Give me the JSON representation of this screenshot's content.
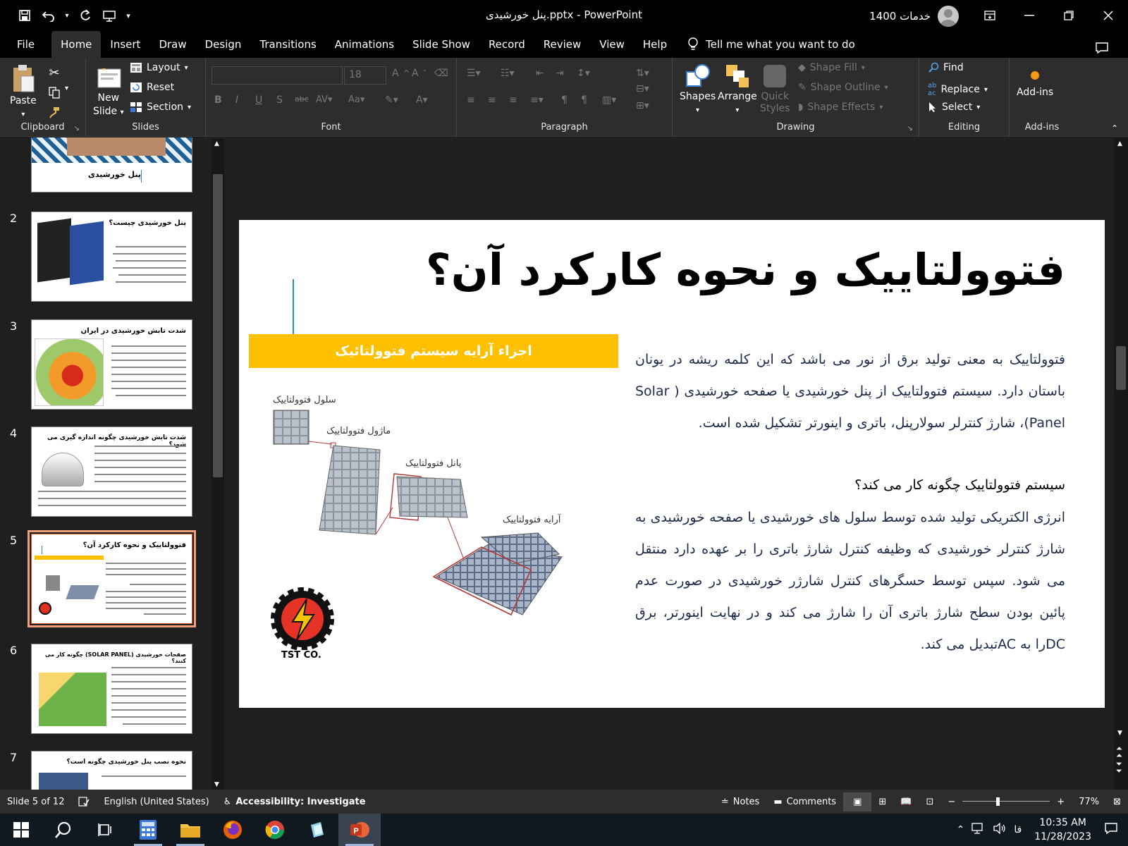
{
  "window": {
    "doc_title": "پنل خورشیدی.pptx  -  PowerPoint",
    "account_name": "خدمات 1400"
  },
  "menu": {
    "tabs": [
      "File",
      "Home",
      "Insert",
      "Draw",
      "Design",
      "Transitions",
      "Animations",
      "Slide Show",
      "Record",
      "Review",
      "View",
      "Help"
    ],
    "tell_me": "Tell me what you want to do"
  },
  "ribbon": {
    "clipboard": {
      "paste": "Paste",
      "label": "Clipboard"
    },
    "slides": {
      "new_slide_1": "New",
      "new_slide_2": "Slide",
      "layout": "Layout",
      "reset": "Reset",
      "section": "Section",
      "label": "Slides"
    },
    "font": {
      "size": "18",
      "label": "Font"
    },
    "paragraph": {
      "label": "Paragraph"
    },
    "drawing": {
      "shapes": "Shapes",
      "arrange": "Arrange",
      "quick_1": "Quick",
      "quick_2": "Styles",
      "shape_fill": "Shape Fill",
      "shape_outline": "Shape Outline",
      "shape_effects": "Shape Effects",
      "label": "Drawing"
    },
    "editing": {
      "find": "Find",
      "replace": "Replace",
      "select": "Select",
      "label": "Editing"
    },
    "addins": {
      "button": "Add-ins",
      "label": "Add-ins"
    }
  },
  "thumbnails": [
    {
      "num": "",
      "title": "پنل خورشیدی"
    },
    {
      "num": "2",
      "title": "پنل خورشیدی چیست؟"
    },
    {
      "num": "3",
      "title": "شدت تابش خورشیدی در ایران"
    },
    {
      "num": "4",
      "title": "شدت تابش خورشیدی چگونه اندازه گیری می شود؟"
    },
    {
      "num": "5",
      "title": "فتوولتاییک و نحوه کارکرد آن؟"
    },
    {
      "num": "6",
      "title": "صفحات خورشیدی (SOLAR PANEL) چگونه کار می کنند؟"
    },
    {
      "num": "7",
      "title": "نحوه نصب پنل خورشیدی چگونه است؟"
    }
  ],
  "slide": {
    "title": "فتوولتاییک و نحوه کارکرد آن؟",
    "banner": "اجزاء آرایه سیستم فتوولتائیک",
    "labels": {
      "cell": "سلول فتوولتاییک",
      "module": "ماژول فتوولتاییک",
      "panel": "پانل فتوولتاییک",
      "array": "آرایه فتوولتاییک"
    },
    "logo_text": "TST CO.",
    "para1": "فتوولتاییک به معنی تولید برق از نور می باشد که این کلمه ریشه در یونان باستان دارد. سیستم فتوولتاییک از پنل خورشیدی یا صفحه خورشیدی ( Solar Panel)، شارژ کنترلر سولارپنل، باتری و اینورتر تشکیل شده است.",
    "subheading": "سیستم فتوولتاییک چگونه کار می کند؟",
    "para2": "انرژی الکتریکی تولید شده توسط سلول های خورشیدی یا صفحه خورشیدی به شارژ کنترلر خورشیدی که وظیفه کنترل شارژ باتری را بر عهده دارد منتقل می شود. سپس توسط حسگرهای کنترل شارژر خورشیدی در صورت عدم پائین بودن سطح شارژ باتری آن را شارژ می کند و در نهایت اینورتر، برق DCرا به ACتبدیل می کند."
  },
  "status": {
    "slide_of": "Slide 5 of 12",
    "language": "English (United States)",
    "accessibility": "Accessibility: Investigate",
    "notes": "Notes",
    "comments": "Comments",
    "zoom": "77%"
  },
  "taskbar": {
    "time": "10:35 AM",
    "date": "11/28/2023",
    "lang": "فا"
  },
  "colors": {
    "banner": "#ffc000",
    "accent": "#2e8bc0",
    "selection": "#d65b2f"
  }
}
